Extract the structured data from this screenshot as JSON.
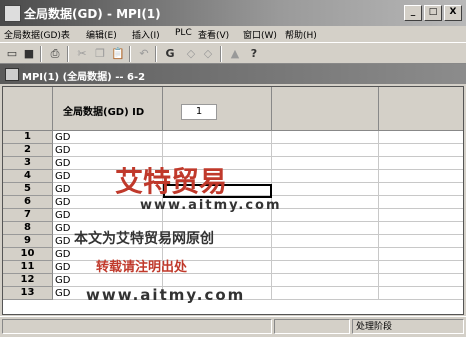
{
  "window": {
    "title": "全局数据(GD) - MPI(1)",
    "buttons": [
      "_",
      "□",
      "X"
    ]
  },
  "menu": [
    "全局数据(GD)表",
    "编辑(E)",
    "插入(I)",
    "PLC",
    "查看(V)",
    "窗口(W)",
    "帮助(H)"
  ],
  "toolbar": {
    "icons": [
      "new-icon",
      "save-icon",
      "print-icon",
      "cut-icon",
      "copy-icon",
      "paste-icon",
      "undo-icon",
      "compile-icon",
      "prev-icon",
      "next-icon",
      "download-icon",
      "help-icon"
    ],
    "glyphs": [
      "▭",
      "■",
      "⎙",
      "✂",
      "❐",
      "📋",
      "↶",
      "G",
      "◇",
      "◇",
      "▲",
      "?"
    ]
  },
  "child_window": {
    "title": "MPI(1) (全局数据) -- 6-2"
  },
  "grid": {
    "header_label": "全局数据(GD) ID",
    "id_value": "1",
    "rows": [
      {
        "num": "1",
        "gd": "GD"
      },
      {
        "num": "2",
        "gd": "GD"
      },
      {
        "num": "3",
        "gd": "GD"
      },
      {
        "num": "4",
        "gd": "GD"
      },
      {
        "num": "5",
        "gd": "GD"
      },
      {
        "num": "6",
        "gd": "GD"
      },
      {
        "num": "7",
        "gd": "GD"
      },
      {
        "num": "8",
        "gd": "GD"
      },
      {
        "num": "9",
        "gd": "GD"
      },
      {
        "num": "10",
        "gd": "GD"
      },
      {
        "num": "11",
        "gd": "GD"
      },
      {
        "num": "12",
        "gd": "GD"
      },
      {
        "num": "13",
        "gd": "GD"
      }
    ]
  },
  "status": {
    "right": "处理阶段"
  },
  "watermark": {
    "brand": "艾特贸易",
    "url1": "www.aitmy.com",
    "line1": "本文为艾特贸易网原创",
    "line2": "转载请注明出处",
    "url2": "www.aitmy.com",
    "color": "#c0392b"
  }
}
